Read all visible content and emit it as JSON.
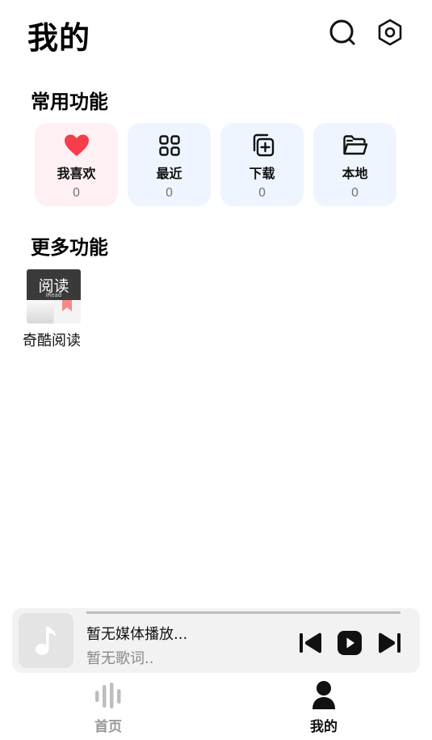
{
  "header": {
    "title": "我的",
    "search_icon": "search-icon",
    "settings_icon": "gear-icon"
  },
  "common": {
    "title": "常用功能",
    "cards": [
      {
        "label": "我喜欢",
        "count": "0",
        "icon": "heart-icon",
        "color": "#f53d4b"
      },
      {
        "label": "最近",
        "count": "0",
        "icon": "grid-icon",
        "color": "#111111"
      },
      {
        "label": "下载",
        "count": "0",
        "icon": "download-copy-icon",
        "color": "#111111"
      },
      {
        "label": "本地",
        "count": "0",
        "icon": "folder-icon",
        "color": "#111111"
      }
    ]
  },
  "more": {
    "title": "更多功能",
    "apps": [
      {
        "name": "奇酷阅读",
        "icon_text": "阅读",
        "icon_subtext": "iRead"
      }
    ]
  },
  "player": {
    "title": "暂无媒体播放...",
    "lyric": "暂无歌词..",
    "progress": 0,
    "cover_icon": "music-note-icon",
    "controls": [
      "skip-previous-icon",
      "play-icon",
      "skip-next-icon"
    ]
  },
  "tabs": [
    {
      "label": "首页",
      "icon": "equalizer-icon",
      "active": false
    },
    {
      "label": "我的",
      "icon": "person-icon",
      "active": true
    }
  ],
  "colors": {
    "favorite_bg": "#fff0f3",
    "card_bg": "#eef5ff",
    "accent_heart": "#f53d4b"
  }
}
